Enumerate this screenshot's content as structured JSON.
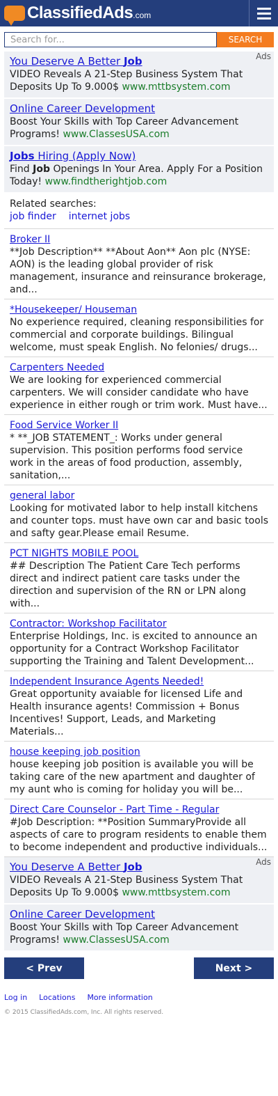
{
  "header": {
    "logo_word1": "Classified",
    "logo_word2": "Ads",
    "logo_suffix": ".com"
  },
  "search": {
    "placeholder": "Search for...",
    "button_label": "SEARCH"
  },
  "ads_label": "Ads",
  "top_ads": [
    {
      "title_pre": "You Deserve A Better ",
      "title_bold": "Job",
      "title_post": "",
      "desc_pre": "VIDEO Reveals A 21-Step Business System That Deposits Up To 9.000$ ",
      "desc_bold": "",
      "desc_post": "",
      "url": "www.mttbsystem.com"
    },
    {
      "title_pre": "Online Career Development",
      "title_bold": "",
      "title_post": "",
      "desc_pre": "Boost Your Skills with Top Career Advancement Programs! ",
      "desc_bold": "",
      "desc_post": "",
      "url": "www.ClassesUSA.com"
    },
    {
      "title_pre": "",
      "title_bold": "Jobs",
      "title_post": " Hiring (Apply Now)",
      "desc_pre": "Find ",
      "desc_bold": "Job",
      "desc_post": " Openings In Your Area. Apply For a Position Today! ",
      "url": "www.findtherightjob.com"
    }
  ],
  "related": {
    "label": "Related searches:",
    "links": [
      "job finder",
      "internet jobs"
    ]
  },
  "listings": [
    {
      "title": "Broker II",
      "desc": "**Job Description** **About Aon** Aon plc (NYSE: AON) is the leading global provider of risk management, insurance and reinsurance brokerage, and..."
    },
    {
      "title": "*Housekeeper/ Houseman",
      "desc": "No experience required, cleaning responsibilities for commercial and corporate buildings. Bilingual welcome, must speak English. No felonies/ drugs..."
    },
    {
      "title": "Carpenters Needed",
      "desc": "We are looking for experienced commercial carpenters. We will consider candidate who have experience in either rough or trim work. Must have..."
    },
    {
      "title": "Food Service Worker II",
      "desc": "* **_JOB STATEMENT_: Works under general supervision. This position performs food service work in the areas of food production, assembly, sanitation,..."
    },
    {
      "title": "general labor",
      "desc": "Looking for motivated labor to help install kitchens and counter tops. must have own car and basic tools and safty gear.Please email Resume."
    },
    {
      "title": "PCT NIGHTS MOBILE POOL",
      "desc": "## Description The Patient Care Tech performs direct and indirect patient care tasks under the direction and supervision of the RN or LPN along with..."
    },
    {
      "title": "Contractor: Workshop Facilitator",
      "desc": "Enterprise Holdings, Inc. is excited to announce an opportunity for a Contract Workshop Facilitator supporting the Training and Talent Development..."
    },
    {
      "title": "Independent Insurance Agents Needed!",
      "desc": "Great opportunity avaiable for licensed Life and Health insurance agents! Commission + Bonus Incentives! Support, Leads, and Marketing Materials..."
    },
    {
      "title": "house keeping job position",
      "desc": "house keeping job position is available you will be taking care of the new apartment and daughter of my aunt who is coming for holiday you will be..."
    },
    {
      "title": "Direct Care Counselor - Part Time - Regular",
      "desc": "#Job Description: **Position SummaryProvide all aspects of care to program residents to enable them to become independent and productive individuals..."
    }
  ],
  "bottom_ads": [
    {
      "title_pre": "You Deserve A Better ",
      "title_bold": "Job",
      "title_post": "",
      "desc_pre": "VIDEO Reveals A 21-Step Business System That Deposits Up To 9.000$ ",
      "desc_bold": "",
      "desc_post": "",
      "url": "www.mttbsystem.com"
    },
    {
      "title_pre": "Online Career Development",
      "title_bold": "",
      "title_post": "",
      "desc_pre": "Boost Your Skills with Top Career Advancement Programs! ",
      "desc_bold": "",
      "desc_post": "",
      "url": "www.ClassesUSA.com"
    }
  ],
  "pager": {
    "prev": "< Prev",
    "next": "Next >"
  },
  "footer": {
    "links": [
      "Log in",
      "Locations",
      "More information"
    ],
    "copyright": "© 2015 ClassifiedAds.com, Inc. All rights reserved."
  },
  "colors": {
    "brand_navy": "#243e7c",
    "accent_orange": "#f47c20",
    "link_blue": "#1a1ad6",
    "url_green": "#1b7d2b",
    "ad_background": "#eef0f4"
  }
}
